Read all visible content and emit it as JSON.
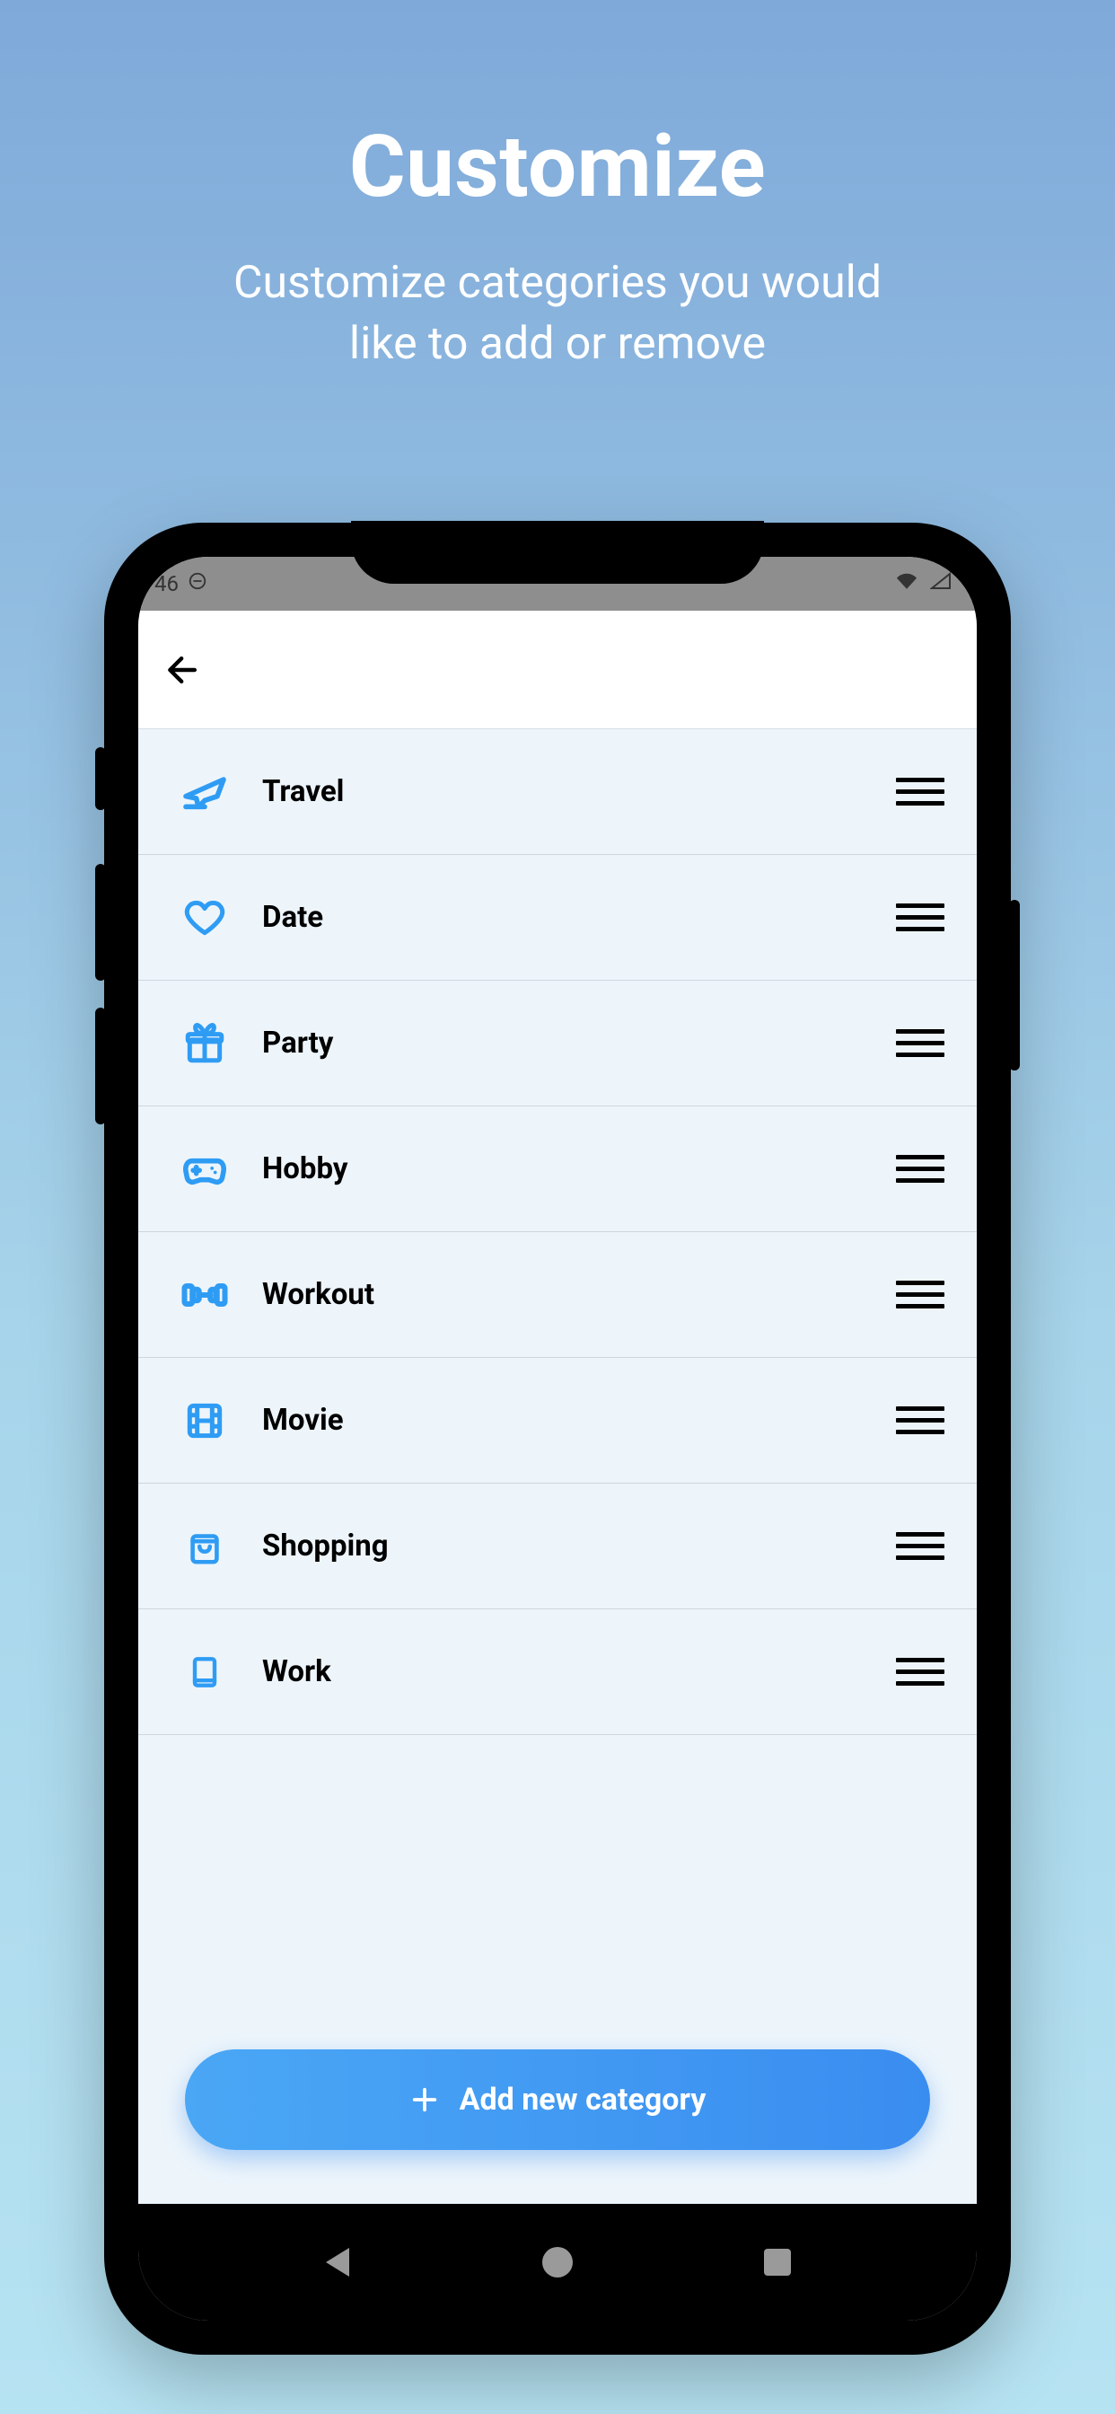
{
  "header": {
    "title": "Customize",
    "subtitle_line1": "Customize categories you would",
    "subtitle_line2": "like to add or remove"
  },
  "statusbar": {
    "time_fragment": "46"
  },
  "categories": [
    {
      "label": "Travel",
      "icon": "plane-icon"
    },
    {
      "label": "Date",
      "icon": "heart-icon"
    },
    {
      "label": "Party",
      "icon": "gift-icon"
    },
    {
      "label": "Hobby",
      "icon": "gamepad-icon"
    },
    {
      "label": "Workout",
      "icon": "dumbbell-icon"
    },
    {
      "label": "Movie",
      "icon": "film-icon"
    },
    {
      "label": "Shopping",
      "icon": "bag-icon"
    },
    {
      "label": "Work",
      "icon": "book-icon"
    }
  ],
  "add_button": {
    "label": "Add new category"
  },
  "colors": {
    "accent": "#2f9cf4",
    "button_gradient_start": "#4aa7f5",
    "button_gradient_end": "#3a8df0"
  }
}
